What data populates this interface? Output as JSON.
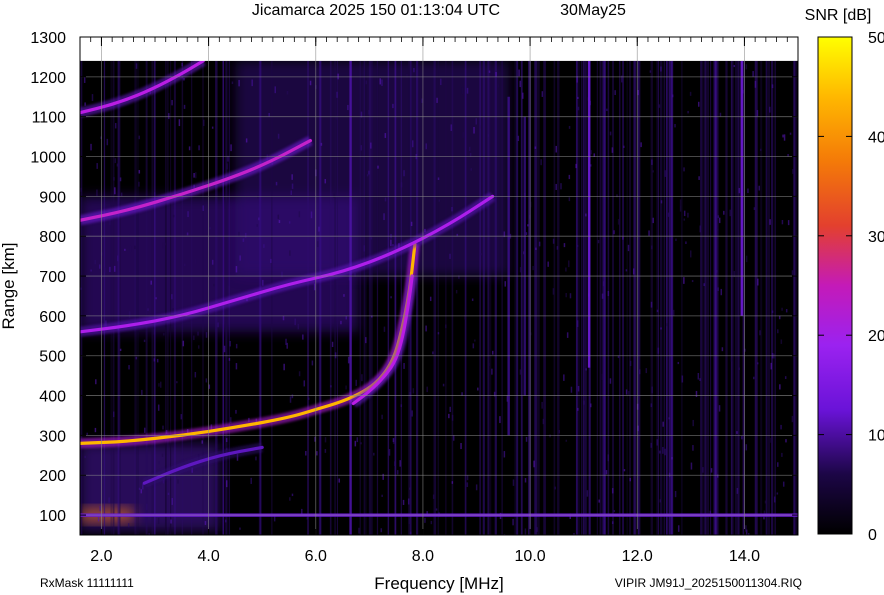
{
  "header": {
    "title": "Jicamarca 2025 150 01:13:04 UTC",
    "date": "30May25"
  },
  "colorbar": {
    "title": "SNR [dB]",
    "ticks": [
      0,
      10,
      20,
      30,
      40,
      50
    ],
    "range": [
      0,
      50
    ]
  },
  "footer": {
    "rxmask": "RxMask 11111111",
    "file": "VIPIR  JM91J_2025150011304.RIQ"
  },
  "chart_data": {
    "type": "heatmap",
    "title": "Jicamarca 2025 150 01:13:04 UTC",
    "xlabel": "Frequency [MHz]",
    "ylabel": "Range [km]",
    "xlim": [
      1.6,
      15.0
    ],
    "ylim": [
      50,
      1300
    ],
    "x_ticks": [
      "2.0",
      "4.0",
      "6.0",
      "8.0",
      "10.0",
      "12.0",
      "14.0"
    ],
    "x_tick_values": [
      2,
      4,
      6,
      8,
      10,
      12,
      14
    ],
    "y_ticks": [
      "100",
      "200",
      "300",
      "400",
      "500",
      "600",
      "700",
      "800",
      "900",
      "1000",
      "1100",
      "1200",
      "1300"
    ],
    "y_tick_values": [
      100,
      200,
      300,
      400,
      500,
      600,
      700,
      800,
      900,
      1000,
      1100,
      1200,
      1300
    ],
    "data_top": 1240,
    "grid": true,
    "colormap": [
      "#000000",
      "#3a0f8c",
      "#8a22ff",
      "#c01ce0",
      "#e3502a",
      "#ff9a00",
      "#ffff00"
    ],
    "traces": [
      {
        "name": "",
        "snr": 44,
        "points": [
          [
            1.6,
            280
          ],
          [
            2.5,
            285
          ],
          [
            3.5,
            300
          ],
          [
            4.5,
            320
          ],
          [
            5.5,
            345
          ],
          [
            6.0,
            365
          ],
          [
            6.5,
            385
          ],
          [
            6.9,
            410
          ],
          [
            7.2,
            440
          ],
          [
            7.45,
            490
          ],
          [
            7.6,
            560
          ],
          [
            7.75,
            660
          ],
          [
            7.85,
            780
          ]
        ]
      },
      {
        "name": "",
        "snr": 24,
        "points": [
          [
            6.7,
            380
          ],
          [
            7.0,
            410
          ],
          [
            7.3,
            450
          ],
          [
            7.5,
            490
          ],
          [
            7.62,
            545
          ],
          [
            7.72,
            620
          ],
          [
            7.8,
            700
          ]
        ]
      },
      {
        "name": "",
        "snr": 22,
        "points": [
          [
            1.6,
            560
          ],
          [
            2.5,
            575
          ],
          [
            3.5,
            600
          ],
          [
            4.5,
            640
          ],
          [
            5.5,
            680
          ],
          [
            6.5,
            710
          ],
          [
            7.5,
            760
          ],
          [
            8.5,
            830
          ],
          [
            9.3,
            900
          ]
        ]
      },
      {
        "name": "",
        "snr": 26,
        "points": [
          [
            1.6,
            840
          ],
          [
            2.5,
            865
          ],
          [
            3.5,
            905
          ],
          [
            4.5,
            950
          ],
          [
            5.2,
            990
          ],
          [
            5.9,
            1040
          ]
        ]
      },
      {
        "name": "",
        "snr": 24,
        "points": [
          [
            1.6,
            1110
          ],
          [
            2.2,
            1130
          ],
          [
            2.8,
            1160
          ],
          [
            3.4,
            1200
          ],
          [
            3.9,
            1240
          ]
        ]
      },
      {
        "name": "",
        "snr": 12,
        "points": [
          [
            2.8,
            180
          ],
          [
            3.5,
            220
          ],
          [
            4.2,
            250
          ],
          [
            5.0,
            270
          ]
        ]
      },
      {
        "name": "",
        "snr": 14,
        "points": [
          [
            1.6,
            100
          ],
          [
            4,
            100
          ],
          [
            8,
            100
          ],
          [
            12,
            100
          ],
          [
            15,
            100
          ]
        ]
      }
    ],
    "vertical_lines": [
      {
        "freq": 11.1,
        "r0": 470,
        "r1": 1240,
        "snr": 14
      },
      {
        "freq": 13.95,
        "r0": 600,
        "r1": 1240,
        "snr": 14
      },
      {
        "freq": 6.65,
        "r0": 50,
        "r1": 1240,
        "snr": 10
      },
      {
        "freq": 9.6,
        "r0": 300,
        "r1": 1150,
        "snr": 8
      },
      {
        "freq": 9.9,
        "r0": 400,
        "r1": 1100,
        "snr": 7
      }
    ],
    "diffuse_regions": [
      {
        "f0": 1.6,
        "f1": 6.8,
        "r0": 560,
        "r1": 900,
        "snr": 9
      },
      {
        "f0": 4.5,
        "f1": 9.6,
        "r0": 700,
        "r1": 1240,
        "snr": 7
      },
      {
        "f0": 1.6,
        "f1": 4.2,
        "r0": 60,
        "r1": 280,
        "snr": 10
      },
      {
        "f0": 1.6,
        "f1": 2.6,
        "r0": 80,
        "r1": 120,
        "snr": 38
      }
    ]
  }
}
